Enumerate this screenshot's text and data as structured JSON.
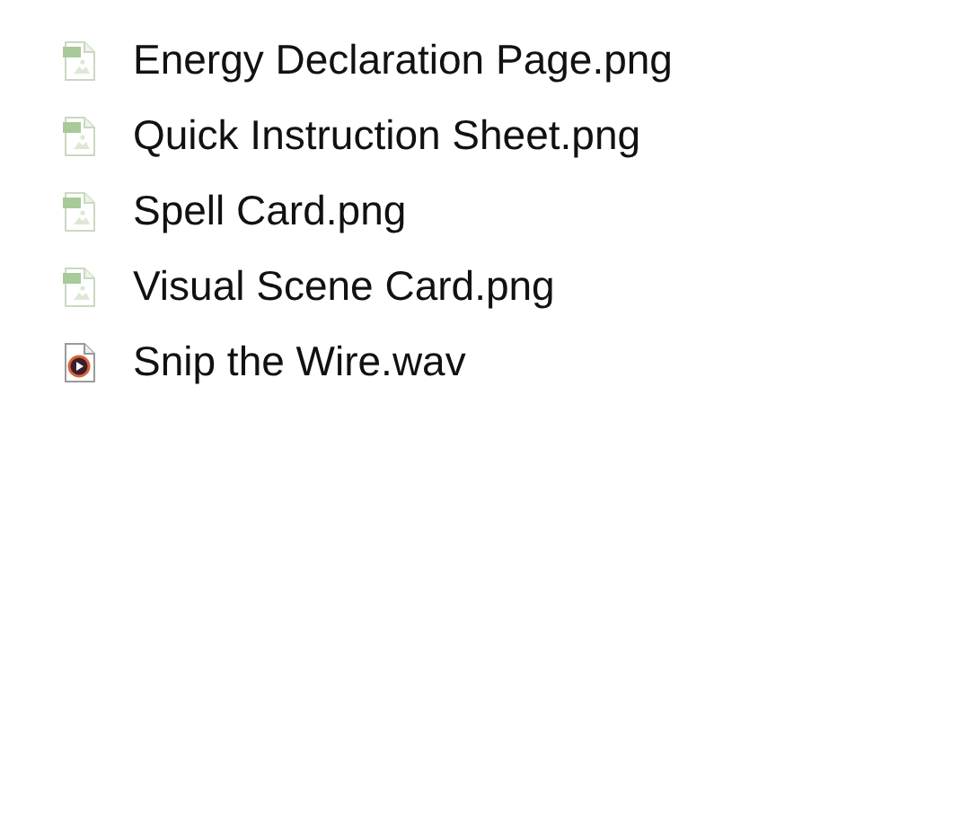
{
  "files": [
    {
      "name": "Energy Declaration Page.png",
      "kind": "image"
    },
    {
      "name": "Quick Instruction Sheet.png",
      "kind": "image"
    },
    {
      "name": "Spell Card.png",
      "kind": "image"
    },
    {
      "name": "Visual Scene Card.png",
      "kind": "image"
    },
    {
      "name": "Snip the Wire.wav",
      "kind": "audio"
    }
  ]
}
